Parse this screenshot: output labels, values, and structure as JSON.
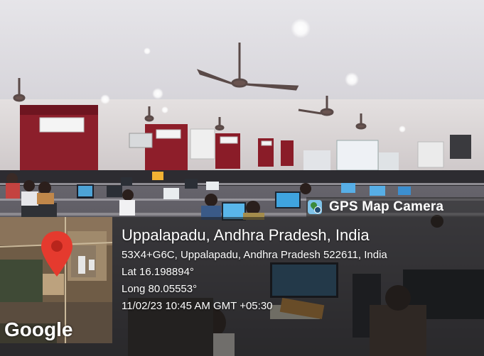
{
  "overlay": {
    "app_title": "GPS Map Camera",
    "app_icon": "gps-map-camera-icon",
    "location_title": "Uppalapadu, Andhra Pradesh, India",
    "address": "53X4+G6C, Uppalapadu, Andhra Pradesh 522611, India",
    "lat": "Lat 16.198894°",
    "long": "Long 80.05553°",
    "datetime": "11/02/23 10:45 AM GMT +05:30",
    "map_provider": "Google",
    "pin_icon": "map-pin-icon",
    "pin_color": "#e53a2e"
  }
}
